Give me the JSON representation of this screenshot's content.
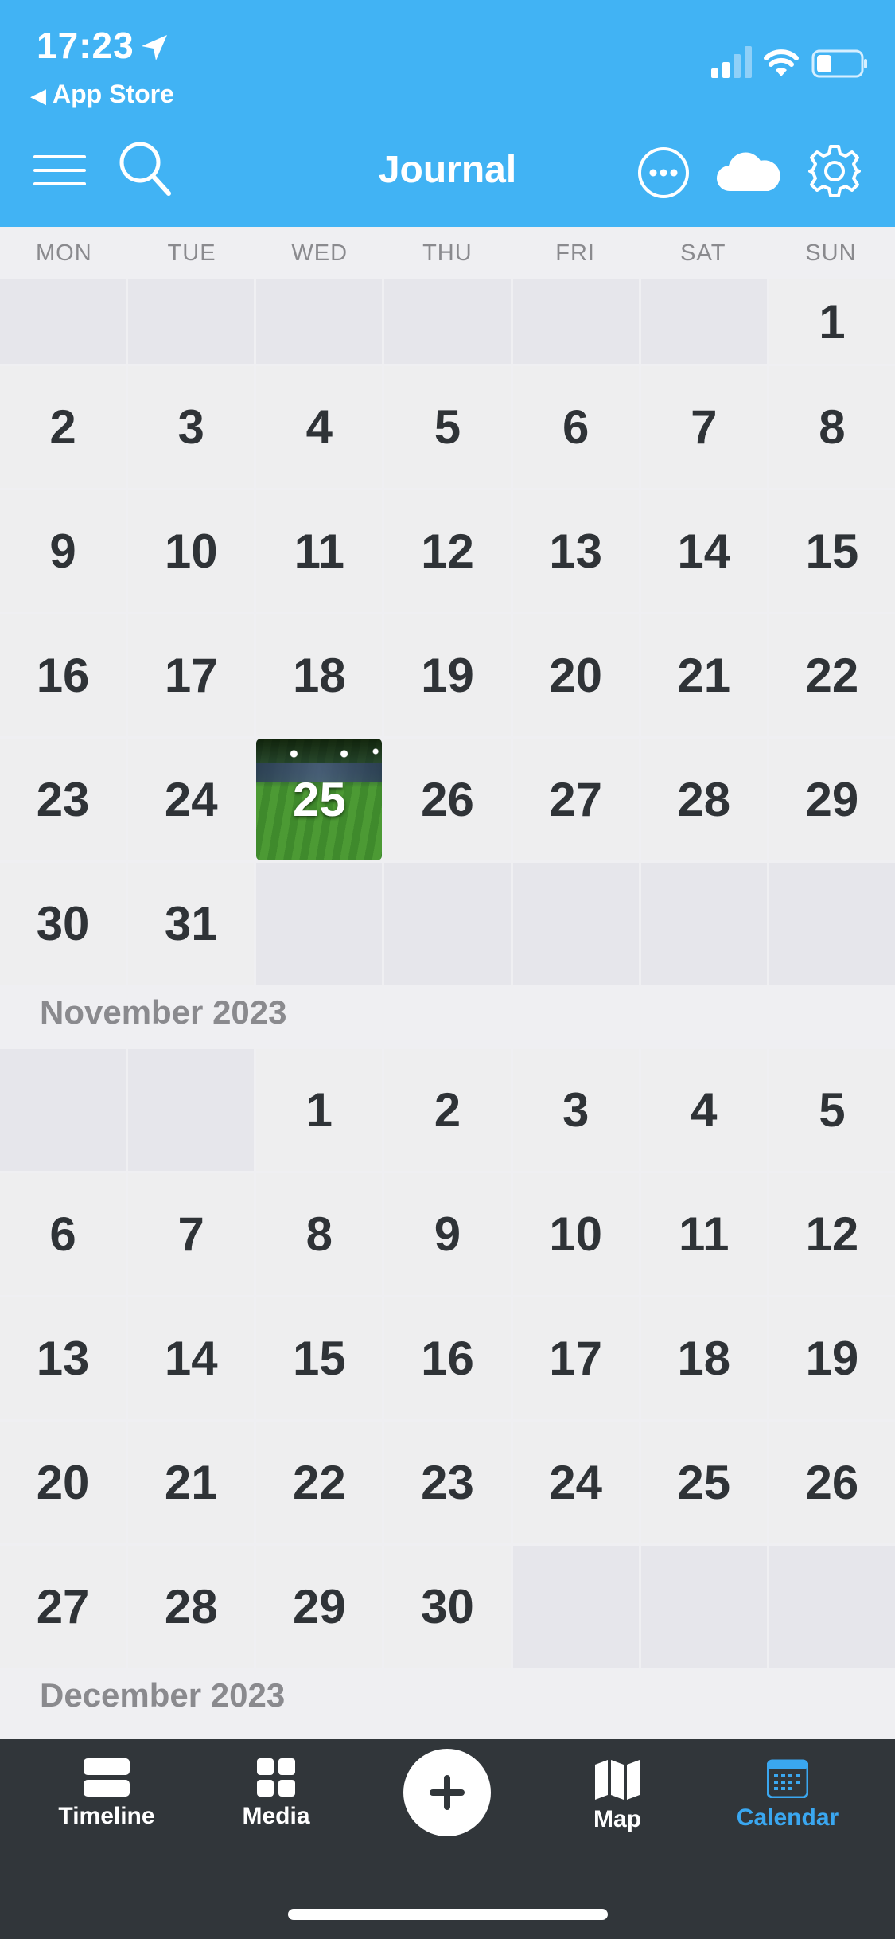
{
  "status": {
    "time": "17:23",
    "back_label": "App Store"
  },
  "header": {
    "title": "Journal"
  },
  "weekdays": [
    "MON",
    "TUE",
    "WED",
    "THU",
    "FRI",
    "SAT",
    "SUN"
  ],
  "october": {
    "days": [
      "",
      "",
      "",
      "",
      "",
      "",
      "1",
      "2",
      "3",
      "4",
      "5",
      "6",
      "7",
      "8",
      "9",
      "10",
      "11",
      "12",
      "13",
      "14",
      "15",
      "16",
      "17",
      "18",
      "19",
      "20",
      "21",
      "22",
      "23",
      "24",
      "25",
      "26",
      "27",
      "28",
      "29",
      "30",
      "31",
      "",
      "",
      "",
      "",
      ""
    ]
  },
  "november": {
    "label": "November 2023",
    "days": [
      "",
      "",
      "1",
      "2",
      "3",
      "4",
      "5",
      "6",
      "7",
      "8",
      "9",
      "10",
      "11",
      "12",
      "13",
      "14",
      "15",
      "16",
      "17",
      "18",
      "19",
      "20",
      "21",
      "22",
      "23",
      "24",
      "25",
      "26",
      "27",
      "28",
      "29",
      "30",
      "",
      "",
      ""
    ]
  },
  "december": {
    "label": "December 2023"
  },
  "tabs": {
    "timeline": "Timeline",
    "media": "Media",
    "map": "Map",
    "calendar": "Calendar"
  },
  "colors": {
    "header": "#41b3f4",
    "tabbar": "#31363a",
    "active_tab": "#3aa7f0"
  }
}
